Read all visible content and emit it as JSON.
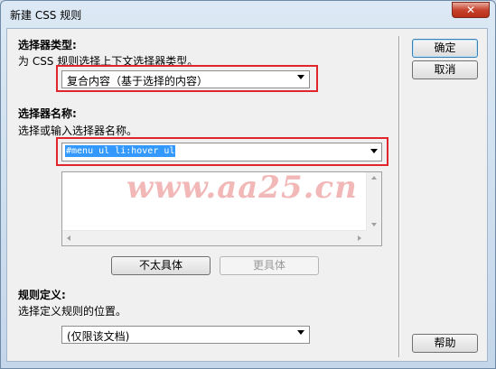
{
  "window": {
    "title": "新建 CSS 规则",
    "close_glyph": "✕"
  },
  "selector_type": {
    "heading": "选择器类型:",
    "description": "为 CSS 规则选择上下文选择器类型。",
    "selected": "复合内容（基于选择的内容）"
  },
  "selector_name": {
    "heading": "选择器名称:",
    "description": "选择或输入选择器名称。",
    "value": "#menu ul li:hover ul"
  },
  "specificity_buttons": {
    "less": "不太具体",
    "more": "更具体"
  },
  "rule_definition": {
    "heading": "规则定义:",
    "description": "选择定义规则的位置。",
    "selected": "(仅限该文档)"
  },
  "buttons": {
    "ok": "确定",
    "cancel": "取消",
    "help": "帮助"
  },
  "watermark": "www.aa25.cn",
  "colors": {
    "highlight_box": "#e0262a",
    "selection": "#3399ff"
  }
}
